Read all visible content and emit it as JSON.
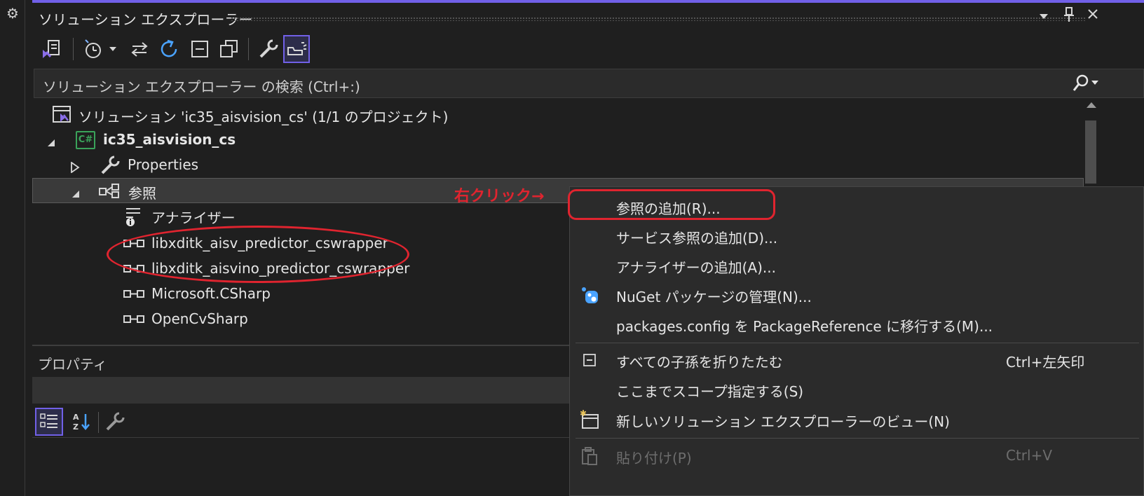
{
  "panel": {
    "title": "ソリューション エクスプローラー",
    "search_placeholder": "ソリューション エクスプローラー の検索 (Ctrl+:)"
  },
  "tree": {
    "solution": "ソリューション 'ic35_aisvision_cs' (1/1 のプロジェクト)",
    "project": "ic35_aisvision_cs",
    "project_icon_text": "C#",
    "properties": "Properties",
    "references": "参照",
    "analyzers": "アナライザー",
    "refs": [
      "libxditk_aisv_predictor_cswrapper",
      "libxditk_aisvino_predictor_cswrapper",
      "Microsoft.CSharp",
      "OpenCvSharp"
    ]
  },
  "annotation": {
    "right_click": "右クリック→",
    "color": "#e0242f"
  },
  "properties_panel": {
    "title": "プロパティ"
  },
  "context_menu": {
    "items": [
      {
        "label": "参照の追加(R)...",
        "shortcut": "",
        "icon": "",
        "disabled": false
      },
      {
        "label": "サービス参照の追加(D)...",
        "shortcut": "",
        "icon": "",
        "disabled": false
      },
      {
        "label": "アナライザーの追加(A)...",
        "shortcut": "",
        "icon": "",
        "disabled": false
      },
      {
        "label": "NuGet パッケージの管理(N)...",
        "shortcut": "",
        "icon": "nuget-icon",
        "disabled": false
      },
      {
        "label": "packages.config を PackageReference に移行する(M)...",
        "shortcut": "",
        "icon": "",
        "disabled": false
      },
      {
        "label": "すべての子孫を折りたたむ",
        "shortcut": "Ctrl+左矢印",
        "icon": "collapse-all-icon",
        "disabled": false
      },
      {
        "label": "ここまでスコープ指定する(S)",
        "shortcut": "",
        "icon": "",
        "disabled": false
      },
      {
        "label": "新しいソリューション エクスプローラーのビュー(N)",
        "shortcut": "",
        "icon": "new-view-icon",
        "disabled": false
      },
      {
        "label": "貼り付け(P)",
        "shortcut": "Ctrl+V",
        "icon": "paste-icon",
        "disabled": true
      }
    ]
  },
  "colors": {
    "accent": "#7160e8",
    "background": "#1f1f1f",
    "menu_background": "#2b2b2b"
  }
}
